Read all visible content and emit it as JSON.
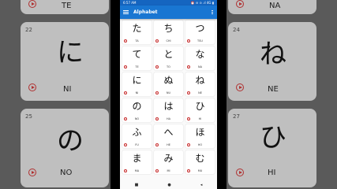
{
  "status": {
    "time": "6:57 AM",
    "icons": "⏰ ⊖ ⊙ .ıl 4G ▮"
  },
  "appbar": {
    "title": "Alphabet"
  },
  "cards": [
    {
      "kana": "た",
      "roma": "TA"
    },
    {
      "kana": "ち",
      "roma": "CHI"
    },
    {
      "kana": "つ",
      "roma": "TSU"
    },
    {
      "kana": "て",
      "roma": "TE"
    },
    {
      "kana": "と",
      "roma": "TO"
    },
    {
      "kana": "な",
      "roma": "NA"
    },
    {
      "kana": "に",
      "roma": "NI"
    },
    {
      "kana": "ぬ",
      "roma": "NU"
    },
    {
      "kana": "ね",
      "roma": "NE"
    },
    {
      "kana": "の",
      "roma": "NO"
    },
    {
      "kana": "は",
      "roma": "HA"
    },
    {
      "kana": "ひ",
      "roma": "HI"
    },
    {
      "kana": "ふ",
      "roma": "FU"
    },
    {
      "kana": "へ",
      "roma": "HE"
    },
    {
      "kana": "ほ",
      "roma": "HO"
    },
    {
      "kana": "ま",
      "roma": "MA"
    },
    {
      "kana": "み",
      "roma": "MI"
    },
    {
      "kana": "む",
      "roma": "MU"
    }
  ],
  "background_left": {
    "top_roma": "TE",
    "card1": {
      "num": "22",
      "kana": "に",
      "roma": "NI"
    },
    "card2": {
      "num": "25",
      "kana": "の",
      "roma": "NO"
    }
  },
  "background_right": {
    "top_roma": "NA",
    "card1": {
      "num": "24",
      "kana": "ね",
      "roma": "NE"
    },
    "card2": {
      "num": "27",
      "kana": "ひ",
      "roma": "HI"
    }
  },
  "navbar": {
    "back": "◂",
    "home": "●",
    "recents": "■"
  }
}
